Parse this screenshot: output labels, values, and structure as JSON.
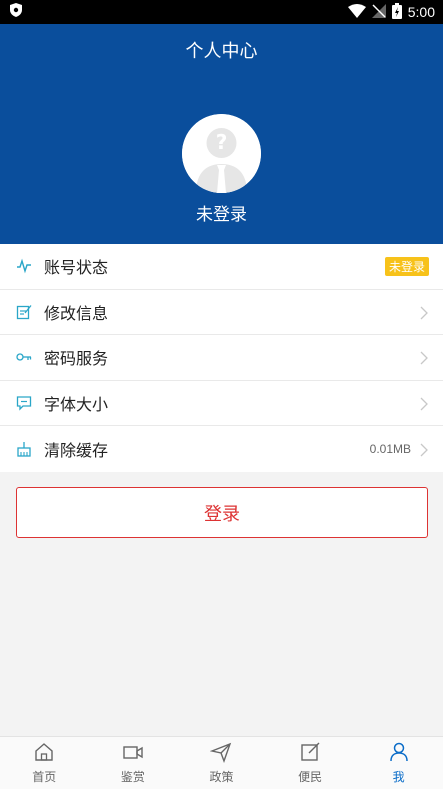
{
  "status_bar": {
    "time": "5:00"
  },
  "header": {
    "title": "个人中心",
    "login_status": "未登录"
  },
  "menu": [
    {
      "label": "账号状态",
      "icon": "pulse-icon",
      "badge": "未登录"
    },
    {
      "label": "修改信息",
      "icon": "edit-icon"
    },
    {
      "label": "密码服务",
      "icon": "key-icon"
    },
    {
      "label": "字体大小",
      "icon": "font-chat-icon"
    },
    {
      "label": "清除缓存",
      "icon": "clean-icon",
      "value": "0.01MB"
    }
  ],
  "login_button": {
    "label": "登录"
  },
  "tabs": [
    {
      "label": "首页",
      "icon": "home-icon"
    },
    {
      "label": "鉴赏",
      "icon": "video-icon"
    },
    {
      "label": "政策",
      "icon": "send-icon"
    },
    {
      "label": "便民",
      "icon": "edit-square-icon"
    },
    {
      "label": "我",
      "icon": "user-icon",
      "active": true
    }
  ],
  "colors": {
    "primary": "#0a4e9c",
    "accent": "#d33333",
    "badge": "#f7c21a",
    "active_tab": "#0a6cc8"
  }
}
